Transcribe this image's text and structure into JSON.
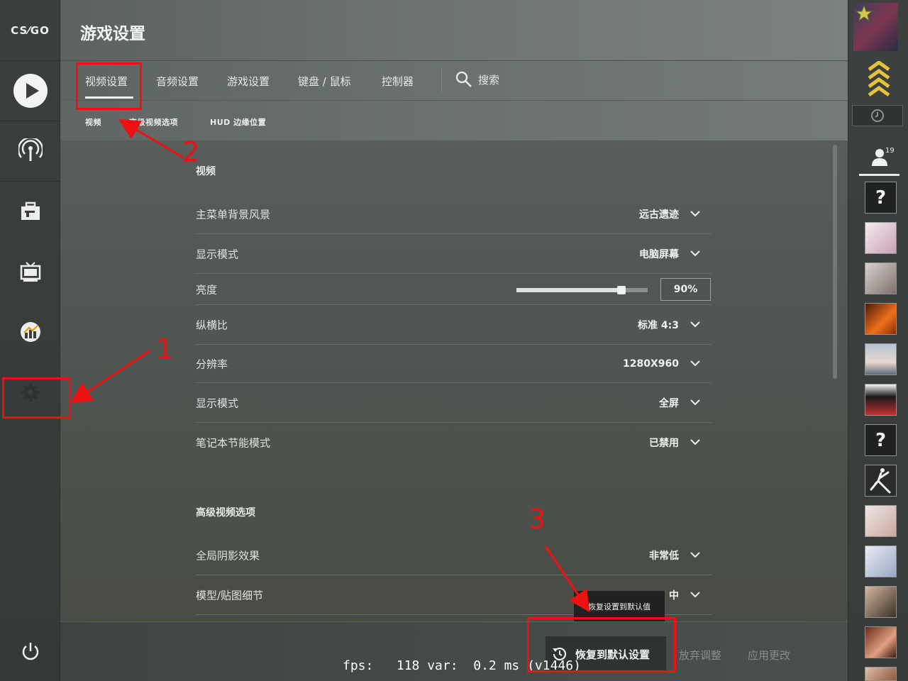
{
  "app": {
    "logo_text": "CS⁄GO",
    "page_title": "游戏设置"
  },
  "sidebar": {
    "items": [
      {
        "name": "play-icon"
      },
      {
        "name": "broadcast-icon"
      },
      {
        "name": "inventory-icon"
      },
      {
        "name": "watch-tv-icon"
      },
      {
        "name": "stats-icon"
      },
      {
        "name": "settings-gear-icon"
      },
      {
        "name": "power-icon"
      }
    ]
  },
  "tabs": [
    {
      "label": "视频设置",
      "active": true
    },
    {
      "label": "音频设置"
    },
    {
      "label": "游戏设置"
    },
    {
      "label": "键盘 / 鼠标"
    },
    {
      "label": "控制器"
    }
  ],
  "search": {
    "label": "搜索"
  },
  "subtabs": [
    {
      "label": "视频"
    },
    {
      "label": "高级视频选项"
    },
    {
      "label": "HUD 边缘位置"
    }
  ],
  "video": {
    "title": "视频",
    "rows": [
      {
        "label": "主菜单背景风景",
        "value": "远古遗迹"
      },
      {
        "label": "显示模式",
        "value": "电脑屏幕"
      },
      {
        "label": "亮度",
        "value": "90%",
        "slider_level": 0.8
      },
      {
        "label": "纵横比",
        "value": "标准 4:3"
      },
      {
        "label": "分辨率",
        "value": "1280X960"
      },
      {
        "label": "显示模式",
        "value": "全屏"
      },
      {
        "label": "笔记本节能模式",
        "value": "已禁用"
      }
    ]
  },
  "advanced": {
    "title": "高级视频选项",
    "rows": [
      {
        "label": "全局阴影效果",
        "value": "非常低"
      },
      {
        "label": "模型/贴图细节",
        "value": "中"
      }
    ]
  },
  "tooltip": {
    "text": "恢复设置到默认值"
  },
  "bottom": {
    "restore_label": "恢复到默认设置",
    "discard_label": "放弃调整",
    "apply_label": "应用更改"
  },
  "debug": {
    "fps_text": "fps:   118 var:  0.2 ms (v1446)"
  },
  "friends": {
    "count": "19",
    "unknown_mark": "?"
  },
  "annotations": {
    "n1": "1",
    "n2": "2",
    "n3": "3"
  },
  "colors": {
    "annotation_red": "#ee1111"
  }
}
